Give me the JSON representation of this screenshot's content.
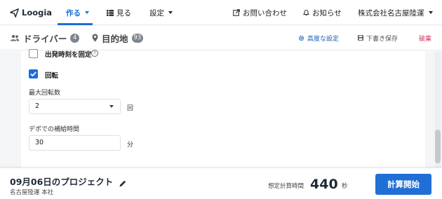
{
  "app": {
    "logo_text": "Loogia"
  },
  "topnav": {
    "items": [
      {
        "label": "作る",
        "active": true
      },
      {
        "label": "見る",
        "icon": "grid-icon"
      },
      {
        "label": "設定"
      }
    ],
    "right": [
      {
        "label": "お問い合わせ",
        "icon": "external-link-icon"
      },
      {
        "label": "お知らせ",
        "icon": "bell-icon"
      },
      {
        "label": "株式会社名古屋陸運"
      }
    ]
  },
  "subheader": {
    "drivers": {
      "label": "ドライバー",
      "count": "4"
    },
    "destinations": {
      "label": "目的地",
      "count": "93"
    },
    "actions": {
      "advanced": "高度な設定",
      "draft": "下書き保存",
      "discard": "破棄"
    }
  },
  "form": {
    "fixed_departure": {
      "label": "出発時刻を固定",
      "checked": false
    },
    "rotation": {
      "label": "回転",
      "checked": true
    },
    "max_rotations": {
      "label": "最大回転数",
      "value": "2",
      "unit": "回"
    },
    "depot_replenish": {
      "label": "デポでの補給時間",
      "value": "30",
      "unit": "分"
    }
  },
  "footer": {
    "project_title": "09月06日のプロジェクト",
    "project_sub": "名古屋陸運 本社",
    "estimate_label": "想定計算時間",
    "estimate_value": "440",
    "estimate_unit": "秒",
    "calc_button": "計算開始"
  },
  "colors": {
    "accent": "#1a6ed8",
    "button": "#1f6fd6",
    "discard": "#d0355e",
    "badge": "#7d848c"
  }
}
